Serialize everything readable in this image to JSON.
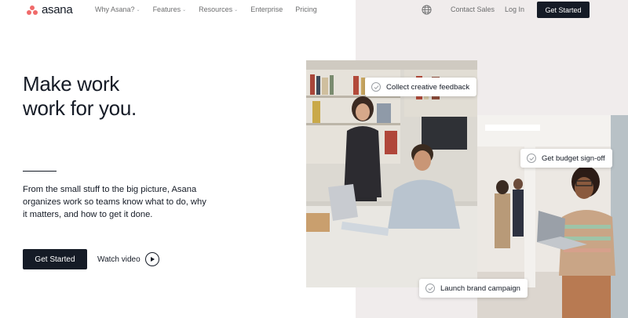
{
  "brand": {
    "name": "asana",
    "accent": "#f06a6a"
  },
  "nav": {
    "links": [
      {
        "label": "Why Asana?",
        "dropdown": true
      },
      {
        "label": "Features",
        "dropdown": true
      },
      {
        "label": "Resources",
        "dropdown": true
      },
      {
        "label": "Enterprise",
        "dropdown": false
      },
      {
        "label": "Pricing",
        "dropdown": false
      }
    ],
    "globe_icon": "globe-icon",
    "contact": "Contact Sales",
    "login": "Log In",
    "cta": "Get Started"
  },
  "hero": {
    "title_line1": "Make work",
    "title_line2": "work for you.",
    "description": "From the small stuff to the big picture, Asana organizes work so teams know what to do, why it matters, and how to get it done.",
    "cta": "Get Started",
    "watch": "Watch video"
  },
  "badges": {
    "b1": "Collect creative feedback",
    "b2": "Get budget sign-off",
    "b3": "Launch brand campaign"
  },
  "colors": {
    "dark": "#151b26",
    "panel": "#f0ecec"
  }
}
